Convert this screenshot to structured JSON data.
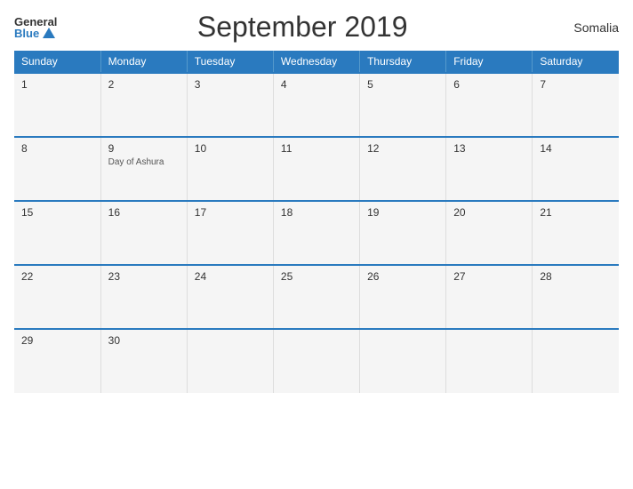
{
  "header": {
    "logo_general": "General",
    "logo_blue": "Blue",
    "title": "September 2019",
    "country": "Somalia"
  },
  "calendar": {
    "weekdays": [
      "Sunday",
      "Monday",
      "Tuesday",
      "Wednesday",
      "Thursday",
      "Friday",
      "Saturday"
    ],
    "weeks": [
      [
        {
          "day": "1",
          "event": ""
        },
        {
          "day": "2",
          "event": ""
        },
        {
          "day": "3",
          "event": ""
        },
        {
          "day": "4",
          "event": ""
        },
        {
          "day": "5",
          "event": ""
        },
        {
          "day": "6",
          "event": ""
        },
        {
          "day": "7",
          "event": ""
        }
      ],
      [
        {
          "day": "8",
          "event": ""
        },
        {
          "day": "9",
          "event": "Day of Ashura"
        },
        {
          "day": "10",
          "event": ""
        },
        {
          "day": "11",
          "event": ""
        },
        {
          "day": "12",
          "event": ""
        },
        {
          "day": "13",
          "event": ""
        },
        {
          "day": "14",
          "event": ""
        }
      ],
      [
        {
          "day": "15",
          "event": ""
        },
        {
          "day": "16",
          "event": ""
        },
        {
          "day": "17",
          "event": ""
        },
        {
          "day": "18",
          "event": ""
        },
        {
          "day": "19",
          "event": ""
        },
        {
          "day": "20",
          "event": ""
        },
        {
          "day": "21",
          "event": ""
        }
      ],
      [
        {
          "day": "22",
          "event": ""
        },
        {
          "day": "23",
          "event": ""
        },
        {
          "day": "24",
          "event": ""
        },
        {
          "day": "25",
          "event": ""
        },
        {
          "day": "26",
          "event": ""
        },
        {
          "day": "27",
          "event": ""
        },
        {
          "day": "28",
          "event": ""
        }
      ],
      [
        {
          "day": "29",
          "event": ""
        },
        {
          "day": "30",
          "event": ""
        },
        {
          "day": "",
          "event": ""
        },
        {
          "day": "",
          "event": ""
        },
        {
          "day": "",
          "event": ""
        },
        {
          "day": "",
          "event": ""
        },
        {
          "day": "",
          "event": ""
        }
      ]
    ]
  }
}
